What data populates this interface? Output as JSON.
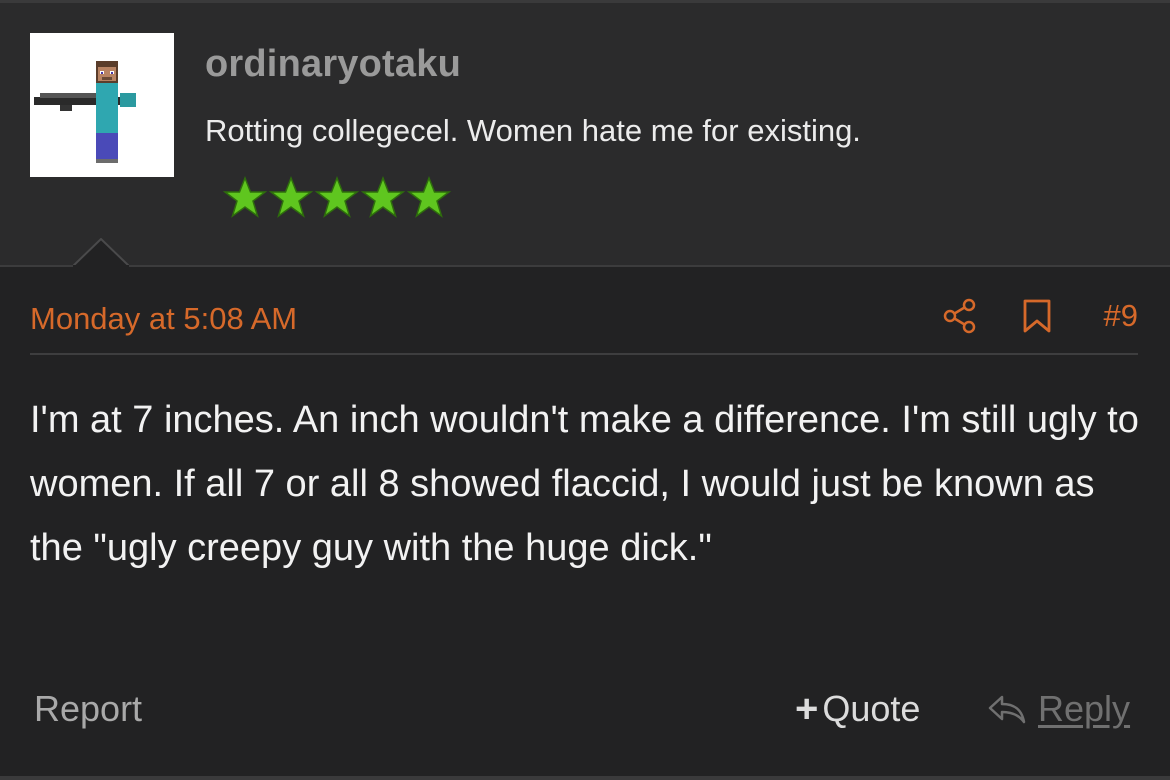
{
  "user": {
    "username": "ordinaryotaku",
    "title": "Rotting collegecel. Women hate me for existing.",
    "rating": 5
  },
  "post": {
    "date": "Monday at 5:08 AM",
    "number": "#9",
    "body": "I'm at 7 inches. An inch wouldn't make a difference. I'm still ugly to women. If all 7 or all 8 showed flaccid, I would just be known as the \"ugly creepy guy with the huge dick.\""
  },
  "footer": {
    "report_label": "Report",
    "quote_label": "Quote",
    "quote_prefix": "+",
    "reply_label": "Reply"
  },
  "colors": {
    "accent": "#d6692a",
    "star": "#5fc61f",
    "background": "#222223",
    "header_background": "#2b2b2c"
  },
  "icons": {
    "share": "share-icon",
    "bookmark": "bookmark-icon",
    "reply": "reply-icon",
    "star": "star-icon"
  }
}
